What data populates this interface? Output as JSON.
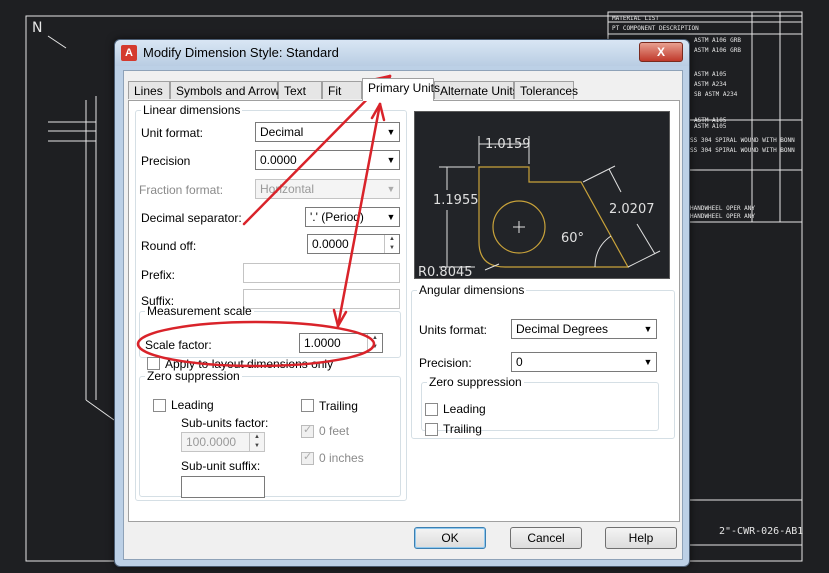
{
  "cad": {
    "north_label": "N",
    "drawing_number": "2\"-CWR-026-AB1",
    "table_header": "MATERIAL LIST",
    "table_subheader": "PT COMPONENT DESCRIPTION",
    "rows": [
      "ASTM A106 GRB",
      "ASTM A106 GRB",
      "ASTM A105",
      "ASTM A234",
      "SB ASTM A234",
      "ASTM A105",
      "ASTM A105",
      "SS 304 SPIRAL WOUND WITH BONN",
      "SS 304 SPIRAL WOUND WITH BONN",
      "HANDWHEEL OPER ANY",
      "HANDWHEEL OPER ANY"
    ]
  },
  "dialog": {
    "title": "Modify Dimension Style: Standard",
    "close_label": "X",
    "tabs": [
      "Lines",
      "Symbols and Arrows",
      "Text",
      "Fit",
      "Primary Units",
      "Alternate Units",
      "Tolerances"
    ],
    "active_tab": "Primary Units",
    "linear": {
      "legend": "Linear dimensions",
      "unit_format_label": "Unit format:",
      "unit_format_value": "Decimal",
      "precision_label": "Precision",
      "precision_value": "0.0000",
      "fraction_format_label": "Fraction format:",
      "fraction_format_value": "Horizontal",
      "decimal_separator_label": "Decimal separator:",
      "decimal_separator_value": "'.' (Period)",
      "round_off_label": "Round off:",
      "round_off_value": "0.0000",
      "prefix_label": "Prefix:",
      "suffix_label": "Suffix:"
    },
    "measurement_scale": {
      "legend": "Measurement scale",
      "scale_factor_label": "Scale factor:",
      "scale_factor_value": "1.0000",
      "apply_layout_label": "Apply to layout dimensions only"
    },
    "zero_suppression_linear": {
      "legend": "Zero suppression",
      "leading_label": "Leading",
      "trailing_label": "Trailing",
      "sub_units_factor_label": "Sub-units factor:",
      "sub_units_factor_value": "100.0000",
      "zero_feet_label": "0 feet",
      "sub_unit_suffix_label": "Sub-unit suffix:",
      "zero_inches_label": "0 inches"
    },
    "preview": {
      "dim_top": "1.0159",
      "dim_left": "1.1955",
      "dim_right": "2.0207",
      "angle": "60°",
      "radius": "R0.8045"
    },
    "angular": {
      "legend": "Angular dimensions",
      "units_format_label": "Units format:",
      "units_format_value": "Decimal Degrees",
      "precision_label": "Precision:",
      "precision_value": "0",
      "zero_suppression_legend": "Zero suppression",
      "leading_label": "Leading",
      "trailing_label": "Trailing"
    },
    "buttons": {
      "ok": "OK",
      "cancel": "Cancel",
      "help": "Help"
    }
  },
  "colors": {
    "annotation": "#d9232a",
    "cad_background": "#1e1f22",
    "cad_lines": "#e6e6e6"
  }
}
